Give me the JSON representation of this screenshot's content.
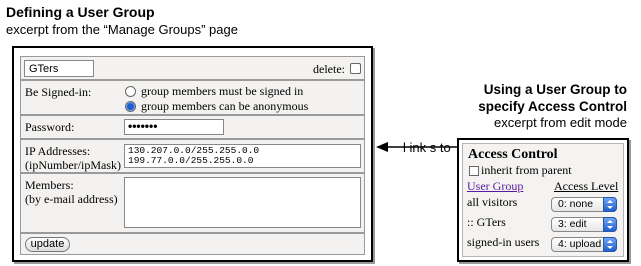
{
  "left_caption": {
    "title": "Defining a User Group",
    "subtitle": "excerpt from the “Manage Groups” page"
  },
  "right_caption": {
    "title_line1": "Using a User Group to",
    "title_line2": "specify Access Control",
    "subtitle": "excerpt from edit mode"
  },
  "group_form": {
    "group_name": "GTers",
    "delete_label": "delete:",
    "signed_in_label": "Be Signed-in:",
    "signed_in_options": [
      {
        "label": "group members must be signed in",
        "selected": false
      },
      {
        "label": "group members can be anonymous",
        "selected": true
      }
    ],
    "password_label": "Password:",
    "password_value": "•••••••",
    "ip_label_line1": "IP Addresses:",
    "ip_label_line2": "(ipNumber/ipMask)",
    "ip_values": [
      "130.207.0.0/255.255.0.0",
      "199.77.0.0/255.255.0.0"
    ],
    "members_label_line1": "Members:",
    "members_label_line2": "(by e-mail address)",
    "members_value": "",
    "update_label": "update"
  },
  "link_annotation": "l ink s to",
  "access_control": {
    "title": "Access Control",
    "inherit_label": "inherit from parent",
    "col_user_group": "User Group",
    "col_access_level": "Access Level",
    "rows": [
      {
        "group": "all visitors",
        "level": "0: none"
      },
      {
        "group": ":: GTers",
        "level": "3: edit"
      },
      {
        "group": "signed-in users",
        "level": "4: upload"
      }
    ]
  },
  "colors": {
    "link": "#5a1aa0",
    "radio_selected": "#1f5fcf",
    "panel_bg": "#f3f2f0"
  }
}
